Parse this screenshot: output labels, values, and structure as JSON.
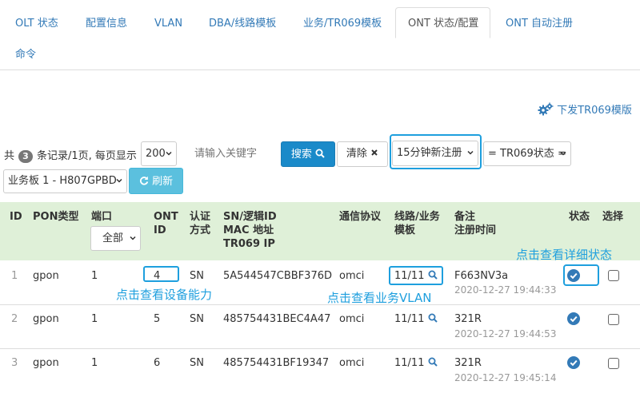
{
  "tabs": [
    {
      "label": "OLT 状态"
    },
    {
      "label": "配置信息"
    },
    {
      "label": "VLAN"
    },
    {
      "label": "DBA/线路模板"
    },
    {
      "label": "业务/TR069模板"
    },
    {
      "label": "ONT 状态/配置"
    },
    {
      "label": "ONT 自动注册"
    },
    {
      "label": "命令"
    }
  ],
  "active_tab": "ONT 状态/配置",
  "push_tr069": {
    "label": "下发TR069模版",
    "icon": "gears-icon"
  },
  "toolbar": {
    "prefix": "共",
    "total": "3",
    "records_text": "条记录/1页, 每页显示",
    "page_size": "200",
    "keyword_placeholder": "请输入关键字",
    "search_label": "搜索",
    "clear_label": "清除",
    "filter_value": "15分钟新注册",
    "tr069_filter": "= TR069状态 =",
    "board_select": "业务板 1 - H807GPBD",
    "refresh_label": "刷新"
  },
  "columns": {
    "id": "ID",
    "pon_type": "PON类型",
    "port": "端口",
    "port_filter": "全部",
    "ont_id_1": "ONT",
    "ont_id_2": "ID",
    "auth_1": "认证",
    "auth_2": "方式",
    "sn_1": "SN/逻辑ID",
    "sn_2": "MAC 地址",
    "sn_3": "TR069 IP",
    "protocol": "通信协议",
    "line_1": "线路/业务",
    "line_2": "模板",
    "note_1": "备注",
    "note_2": "注册时间",
    "status": "状态",
    "select": "选择"
  },
  "rows": [
    {
      "id": "1",
      "pon": "gpon",
      "port": "1",
      "ont": "4",
      "auth": "SN",
      "sn": "5A544547CBBF376D",
      "protocol": "omci",
      "line": "11/11",
      "note": "F663NV3a",
      "time": "2020-12-27 19:44:33"
    },
    {
      "id": "2",
      "pon": "gpon",
      "port": "1",
      "ont": "5",
      "auth": "SN",
      "sn": "485754431BEC4A47",
      "protocol": "omci",
      "line": "11/11",
      "note": "321R",
      "time": "2020-12-27 19:44:53"
    },
    {
      "id": "3",
      "pon": "gpon",
      "port": "1",
      "ont": "6",
      "auth": "SN",
      "sn": "485754431BF19347",
      "protocol": "omci",
      "line": "11/11",
      "note": "321R",
      "time": "2020-12-27 19:45:14"
    }
  ],
  "annotations": {
    "device_capability": "点击查看设备能力",
    "service_vlan": "点击查看业务VLAN",
    "detail_status": "点击查看详细状态"
  },
  "colors": {
    "link": "#337ab7",
    "header_bg": "#dff0d8",
    "primary": "#337ab7",
    "info": "#5bc0de",
    "highlight": "#1e9fde"
  }
}
